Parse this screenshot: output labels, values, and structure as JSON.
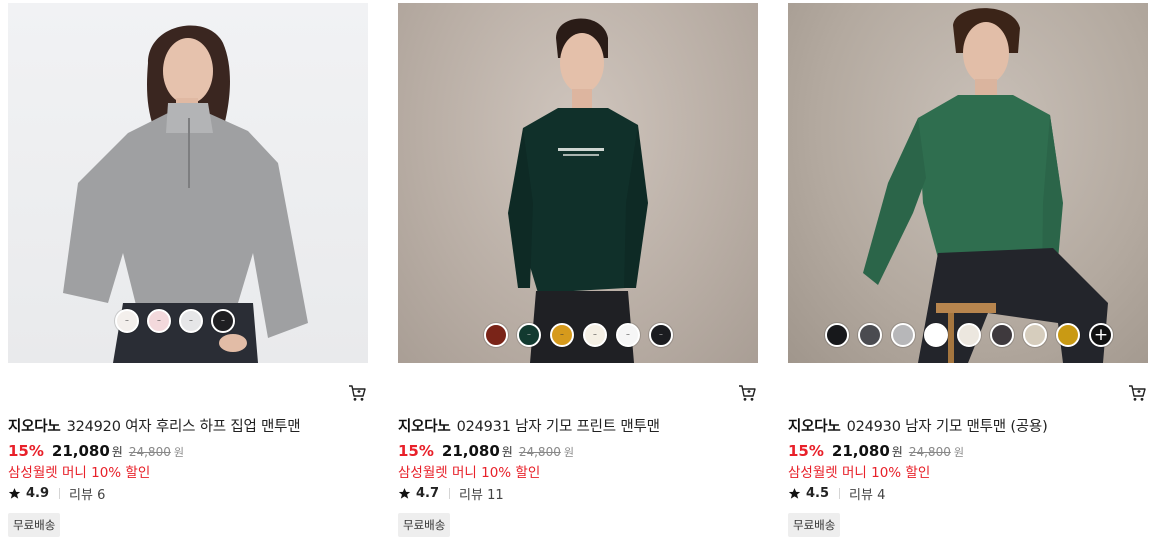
{
  "products": [
    {
      "brand": "지오다노",
      "name": "324920 여자 후리스 하프 집업 맨투맨",
      "discount": "15%",
      "price": "21,080",
      "price_unit": "원",
      "original_price": "24,800",
      "original_unit": "원",
      "promo": "삼성월렛 머니 10% 할인",
      "rating": "4.9",
      "reviews": "리뷰 6",
      "badge": "무료배송",
      "swatches": [
        "#f3efec",
        "#f3d9dc",
        "#e6e6e8",
        "#1f1f22"
      ]
    },
    {
      "brand": "지오다노",
      "name": "024931 남자 기모 프린트 맨투맨",
      "discount": "15%",
      "price": "21,080",
      "price_unit": "원",
      "original_price": "24,800",
      "original_unit": "원",
      "promo": "삼성월렛 머니 10% 할인",
      "rating": "4.7",
      "reviews": "리뷰 11",
      "badge": "무료배송",
      "swatches": [
        "#7a2418",
        "#123a30",
        "#d69a1c",
        "#f4efe4",
        "#f6f6f6",
        "#1b1c20"
      ]
    },
    {
      "brand": "지오다노",
      "name": "024930 남자 기모 맨투맨 (공용)",
      "discount": "15%",
      "price": "21,080",
      "price_unit": "원",
      "original_price": "24,800",
      "original_unit": "원",
      "promo": "삼성월렛 머니 10% 할인",
      "rating": "4.5",
      "reviews": "리뷰 4",
      "badge": "무료배송",
      "swatches": [
        "#17181b",
        "#4a4b50",
        "#b7b7b9",
        "#ffffff",
        "#ece7df",
        "#3e393d",
        "#d6cdbd",
        "#c99a14"
      ]
    }
  ],
  "colors": {
    "discount": "#e8212a",
    "promo": "#e8212a",
    "badge_bg": "#eeeeee"
  },
  "icons": {
    "cart": "cart-icon",
    "star": "star-icon",
    "more_colors": "plus-icon"
  }
}
